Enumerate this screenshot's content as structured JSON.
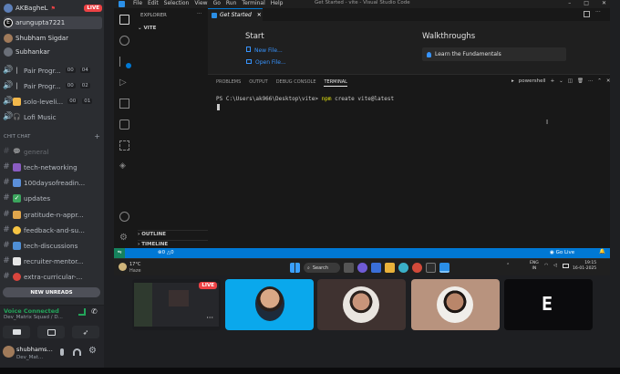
{
  "discord": {
    "voice_users": [
      {
        "name": "AKBagheL",
        "live": "LIVE"
      },
      {
        "name": "arungupta7221"
      },
      {
        "name": "Shubham Sigdar"
      },
      {
        "name": "Subhankar"
      }
    ],
    "voice_channels": [
      {
        "label": "Pair Progr...",
        "a": "00",
        "b": "04"
      },
      {
        "label": "Pair Progr...",
        "a": "00",
        "b": "02"
      },
      {
        "label": "solo-leveli...",
        "a": "00",
        "b": "01"
      },
      {
        "label": "Lofi Music"
      }
    ],
    "category": "CHIT CHAT",
    "text_channels": [
      {
        "label": "general"
      },
      {
        "label": "tech-networking"
      },
      {
        "label": "100daysofreadin..."
      },
      {
        "label": "updates"
      },
      {
        "label": "gratitude-n-appr..."
      },
      {
        "label": "feedback-and-su..."
      },
      {
        "label": "tech-discussions"
      },
      {
        "label": "recruiter-mentor..."
      },
      {
        "label": "extra-curricular-..."
      }
    ],
    "new_unreads": "NEW UNREADS",
    "voice_status": "Voice Connected",
    "voice_sub": "Dev_Matrix Squad / D...",
    "user_name": "shubhams...",
    "user_sub": "Dev_Mat..."
  },
  "vscode": {
    "menu": [
      "File",
      "Edit",
      "Selection",
      "View",
      "Go",
      "Run",
      "Terminal",
      "Help"
    ],
    "window_title": "Get Started - vite - Visual Studio Code",
    "explorer_label": "EXPLORER",
    "folder": "VITE",
    "outline": "OUTLINE",
    "timeline": "TIMELINE",
    "tab": "Get Started",
    "start_heading": "Start",
    "new_file": "New File...",
    "open_file": "Open File...",
    "walkthroughs": "Walkthroughs",
    "fundamentals": "Learn the Fundamentals",
    "panel_tabs": [
      "PROBLEMS",
      "OUTPUT",
      "DEBUG CONSOLE",
      "TERMINAL"
    ],
    "shell": "powershell",
    "prompt": "PS C:\\Users\\ak966\\Desktop\\vite>",
    "cmd": "npm",
    "cmd_args": "create vite@latest",
    "status_left": "0",
    "status_warn": "0",
    "status_right": "Go Live"
  },
  "taskbar": {
    "weather": "17°C",
    "weather_sub": "Haze",
    "search": "Search",
    "lang": "ENG",
    "lang_sub": "IN",
    "time": "19:15",
    "date": "16-01-2025"
  },
  "tiles": {
    "live": "LIVE",
    "last_initial": "E"
  }
}
